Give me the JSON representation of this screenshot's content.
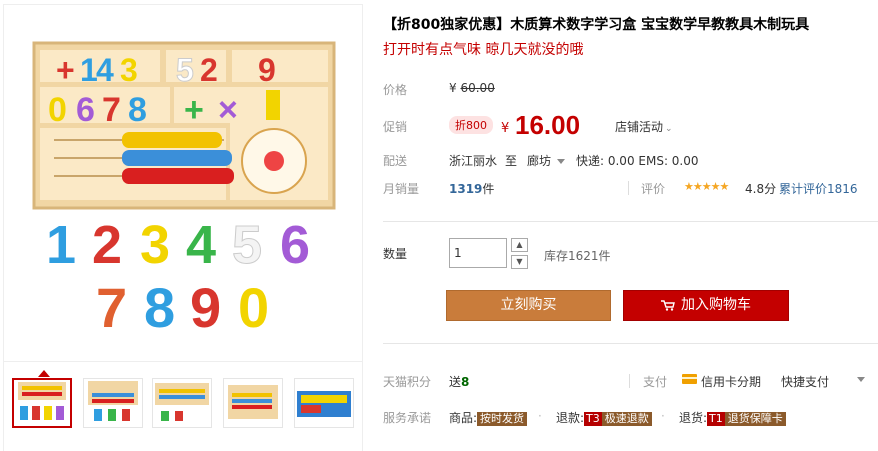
{
  "product": {
    "title": "【折800独家优惠】木质算术数字学习盒 宝宝数学早教教具木制玩具",
    "subtitle": "打开时有点气味 晾几天就没的哦"
  },
  "price": {
    "label": "价格",
    "currency": "¥",
    "original": "60.00"
  },
  "promo": {
    "label": "促销",
    "badge": "折800",
    "currency": "¥",
    "price": "16.00",
    "store_activity": "店铺活动"
  },
  "shipping": {
    "label": "配送",
    "from": "浙江丽水",
    "to_word": "至",
    "to_city": "廊坊",
    "fee_text": "快递: 0.00 EMS: 0.00"
  },
  "sales": {
    "label": "月销量",
    "count": "1319",
    "unit": "件",
    "rating_label": "评价",
    "stars": "★★★★★",
    "score": "4.8分",
    "cumulative": "累计评价1816"
  },
  "quantity": {
    "label": "数量",
    "value": "1",
    "up_icon": "▲",
    "down_icon": "▼",
    "stock": "库存1621件"
  },
  "actions": {
    "buy_now": "立刻购买",
    "add_to_cart": "加入购物车"
  },
  "tmall": {
    "points_label": "天猫积分",
    "points_prefix": "送",
    "points_value": "8",
    "pay_label": "支付",
    "installment": "信用卡分期",
    "quickpay": "快捷支付"
  },
  "service": {
    "label": "服务承诺",
    "goods_label": "商品:",
    "goods_tag": "按时发货",
    "refund_label": "退款:",
    "refund_letter": "T3",
    "refund_tag": "极速退款",
    "return_label": "退货:",
    "return_letter": "T1",
    "return_tag": "退货保障卡",
    "separator": "·"
  },
  "product_image_digits": {
    "row_top": [
      "1",
      "2",
      "3",
      "4",
      "5",
      "6"
    ],
    "row_bottom": [
      "7",
      "8",
      "9",
      "0"
    ],
    "box_top": [
      "+",
      "1",
      "4",
      "3",
      "5",
      "2",
      "9"
    ],
    "box_mid": [
      "0",
      "6",
      "7",
      "8"
    ],
    "box_ops": [
      "+",
      "×",
      "÷"
    ]
  },
  "colors": {
    "accent_red": "#c40000",
    "buy_brown": "#c97c3b",
    "link_blue": "#336699"
  }
}
